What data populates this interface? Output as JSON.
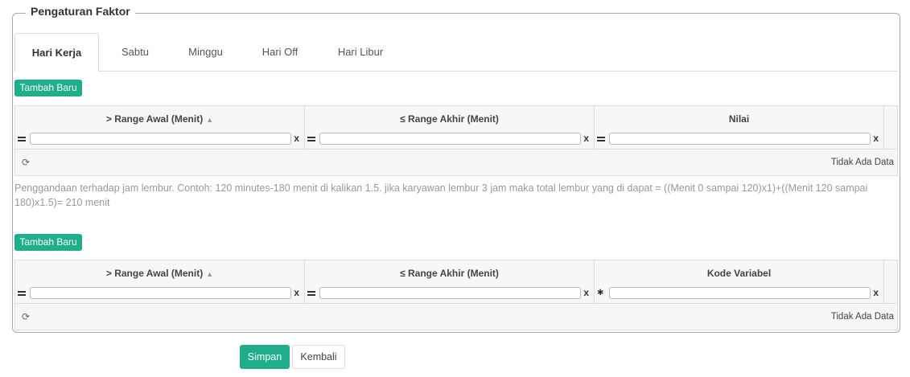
{
  "legend": "Pengaturan Faktor",
  "tabs": [
    {
      "label": "Hari Kerja",
      "active": true
    },
    {
      "label": "Sabtu",
      "active": false
    },
    {
      "label": "Minggu",
      "active": false
    },
    {
      "label": "Hari Off",
      "active": false
    },
    {
      "label": "Hari Libur",
      "active": false
    }
  ],
  "grid1": {
    "add_label": "Tambah Baru",
    "columns": [
      "> Range Awal (Menit)",
      "≤ Range Akhir (Menit)",
      "Nilai"
    ],
    "clear": "x",
    "empty_text": "Tidak Ada Data"
  },
  "help_text": "Penggandaan terhadap jam lembur. Contoh: 120 minutes-180 menit di kalikan 1.5. jika karyawan lembur 3 jam maka total lembur yang di dapat = ((Menit 0 sampai 120)x1)+((Menit 120 sampai 180)x1.5)= 210 menit",
  "grid2": {
    "add_label": "Tambah Baru",
    "columns": [
      "> Range Awal (Menit)",
      "≤ Range Akhir (Menit)",
      "Kode Variabel"
    ],
    "clear": "x",
    "empty_text": "Tidak Ada Data"
  },
  "actions": {
    "save": "Simpan",
    "back": "Kembali"
  },
  "colors": {
    "accent": "#1fae8c"
  }
}
